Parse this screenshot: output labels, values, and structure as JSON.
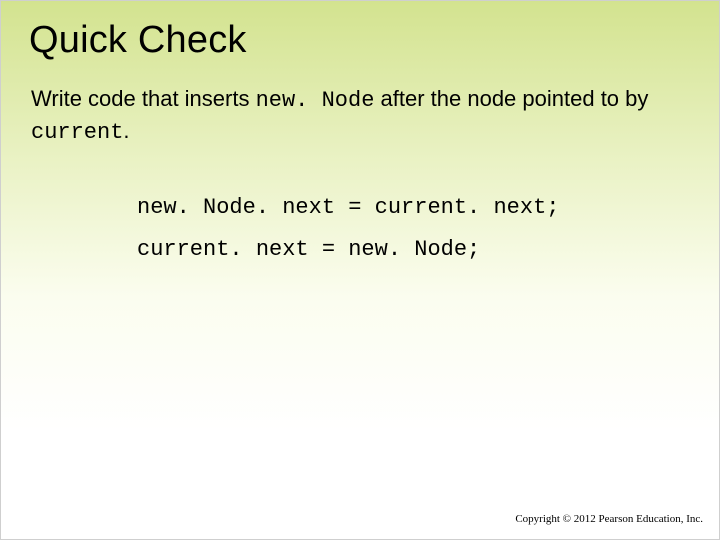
{
  "title": "Quick Check",
  "prompt": {
    "t1": "Write code that inserts ",
    "code1": "new. Node",
    "t2": " after the node pointed to by ",
    "code2": "current",
    "t3": "."
  },
  "code": {
    "line1": "new. Node. next = current. next;",
    "line2": "current. next = new. Node;"
  },
  "copyright": "Copyright © 2012 Pearson Education, Inc."
}
